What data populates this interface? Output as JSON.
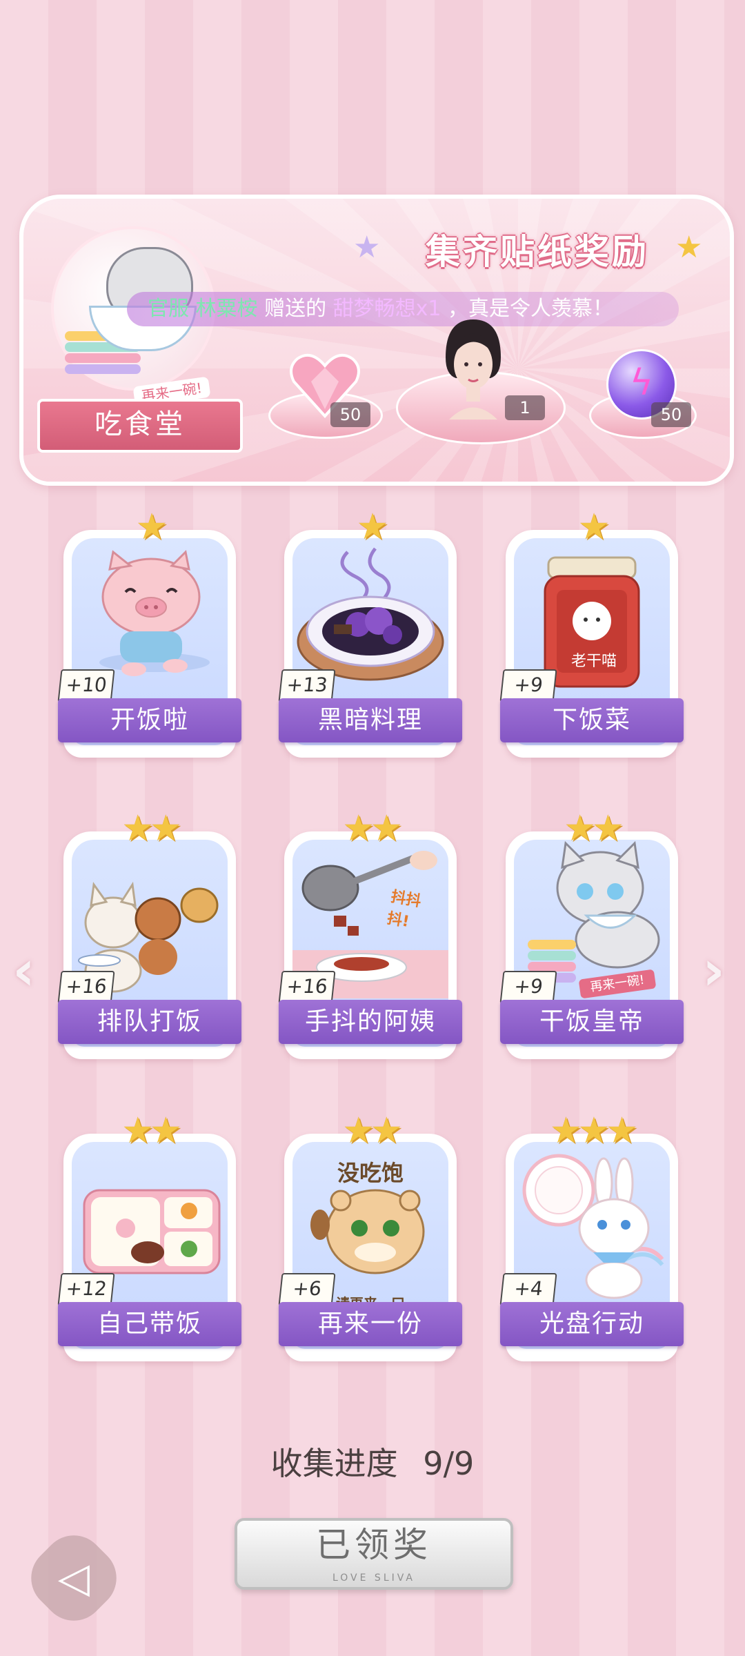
{
  "banner": {
    "title": "集齐贴纸奖励",
    "marquee_prefix": "官服",
    "marquee_name": "林粟桉",
    "marquee_mid": "赠送的",
    "marquee_item": "甜梦畅想x1",
    "marquee_suffix": "，真是令人羡慕！",
    "category_label": "吃食堂",
    "category_tag": "再来一碗!",
    "rewards": [
      {
        "icon": "pink-heart-gem-icon",
        "count": "50"
      },
      {
        "icon": "avatar-portrait",
        "count": "1"
      },
      {
        "icon": "purple-energy-orb-icon",
        "count": "50"
      }
    ]
  },
  "cards": [
    {
      "label": "开饭啦",
      "plus": "+10",
      "stars": "★",
      "art": "pig"
    },
    {
      "label": "黑暗料理",
      "plus": "+13",
      "stars": "★",
      "art": "dark-dish"
    },
    {
      "label": "下饭菜",
      "plus": "+9",
      "stars": "★",
      "art": "chili-jar",
      "jar_text": "老干喵"
    },
    {
      "label": "排队打饭",
      "plus": "+16",
      "stars": "★★",
      "art": "animals-queue"
    },
    {
      "label": "手抖的阿姨",
      "plus": "+16",
      "stars": "★★",
      "art": "ladle",
      "art_text": "抖抖抖!"
    },
    {
      "label": "干饭皇帝",
      "plus": "+9",
      "stars": "★★",
      "art": "cat-rice",
      "art_text": "再来一碗!"
    },
    {
      "label": "自己带饭",
      "plus": "+12",
      "stars": "★★",
      "art": "bento"
    },
    {
      "label": "再来一份",
      "plus": "+6",
      "stars": "★★",
      "art": "hamster",
      "art_text_top": "没吃饱",
      "art_text_bottom": "请再来一口"
    },
    {
      "label": "光盘行动",
      "plus": "+4",
      "stars": "★★★",
      "art": "bunny-plate"
    }
  ],
  "progress": {
    "label": "收集进度",
    "value": "9/9"
  },
  "claim_button": {
    "label": "已领奖",
    "sub": "LOVE SLIVA"
  },
  "colors": {
    "accent": "#8456c4",
    "banner": "#f6c7d3",
    "star": "#f4c542"
  }
}
